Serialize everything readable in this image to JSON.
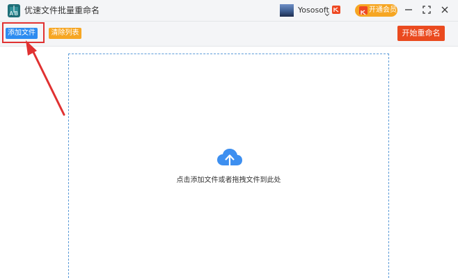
{
  "window": {
    "title": "优速文件批量重命名",
    "app_icon": "ab-rename-icon"
  },
  "account": {
    "username": "Yososoft",
    "avatar": "landscape-avatar",
    "vip_badge_icon": "vip-badge-icon",
    "member_button_label": "开通会员"
  },
  "window_controls": [
    "minimize-icon",
    "maximize-icon",
    "close-icon"
  ],
  "toolbar": {
    "add_files_label": "添加文件",
    "clear_list_label": "清除列表",
    "start_rename_label": "开始重命名"
  },
  "dropzone": {
    "icon": "cloud-upload-icon",
    "hint": "点击添加文件或者拖拽文件到此处"
  },
  "colors": {
    "primary_blue": "#2d8cf0",
    "orange": "#f6a623",
    "red_action": "#ea4a1f",
    "annotation_red": "#e03131",
    "dropzone_border": "#5b9bd8",
    "cloud_blue": "#3d8ff0"
  }
}
